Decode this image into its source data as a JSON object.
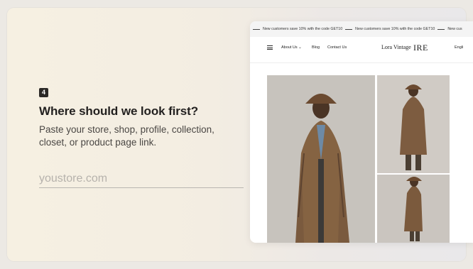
{
  "onboarding": {
    "step_number": "4",
    "question": "Where should we look first?",
    "helper": "Paste your store, shop, profile, collection, closet, or product page link.",
    "input_placeholder": "youstore.com"
  },
  "shop_preview": {
    "announcement": {
      "messages": [
        "New customers save 10% with the code GET10",
        "New customers save 10% with the code GET10",
        "New cus"
      ]
    },
    "nav": {
      "about": "About Us",
      "blog": "Blog",
      "contact": "Contact Us",
      "shop_name": "Lora Vintage",
      "shop_mark": "IRE",
      "language": "Engli"
    },
    "product_photos": [
      "coat-front-photo",
      "coat-back-photo",
      "coat-side-photo"
    ]
  }
}
